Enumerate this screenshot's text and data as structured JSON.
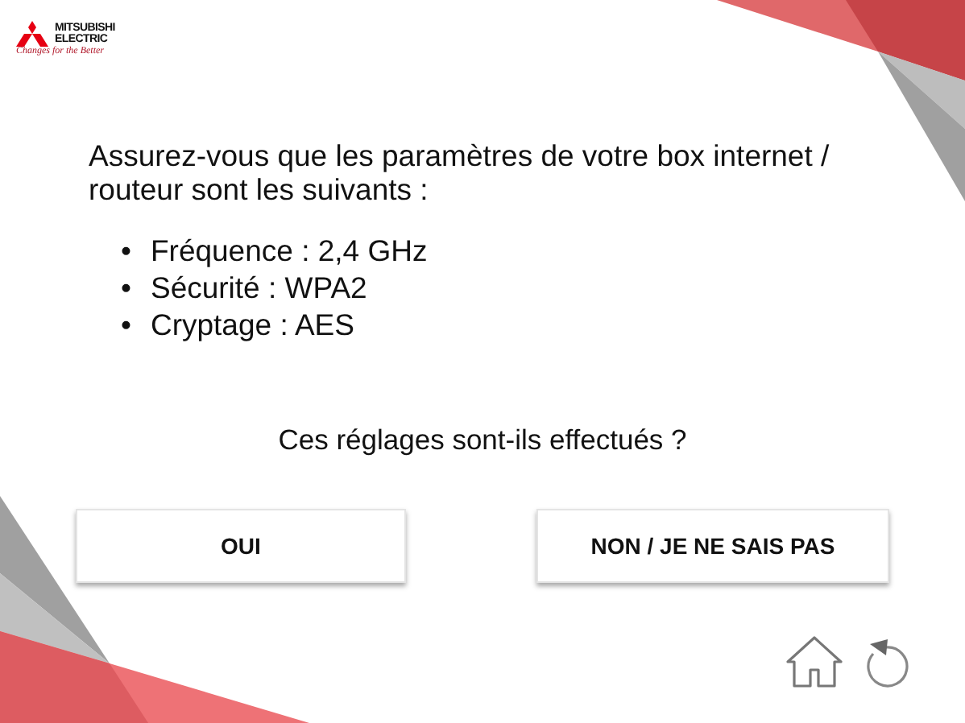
{
  "logo": {
    "name_line_1": "MITSUBISHI",
    "name_line_2": "ELECTRIC",
    "tagline": "Changes for the Better"
  },
  "intro": "Assurez-vous que les paramètres de votre box internet / routeur sont les suivants :",
  "settings": [
    {
      "marker": "•",
      "text": "Fréquence : 2,4 GHz"
    },
    {
      "marker": "•",
      "text": "Sécurité : WPA2"
    },
    {
      "marker": "•",
      "text": "Cryptage : AES"
    }
  ],
  "question": "Ces réglages sont-ils effectués ?",
  "buttons": [
    "OUI",
    "NON / JE NE SAIS PAS"
  ]
}
